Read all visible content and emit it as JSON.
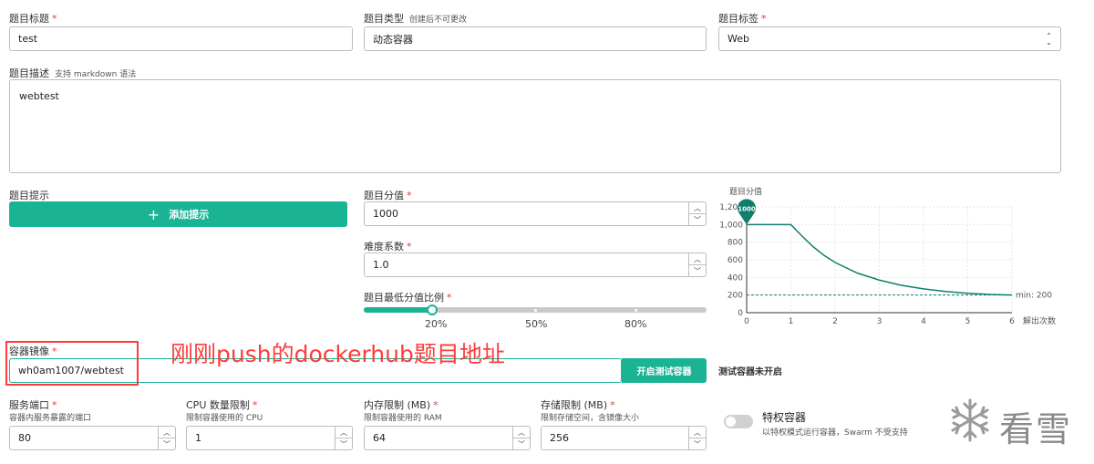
{
  "form": {
    "title": {
      "label": "题目标题",
      "value": "test"
    },
    "type": {
      "label": "题目类型",
      "hint": "创建后不可更改",
      "value": "动态容器"
    },
    "tag": {
      "label": "题目标签",
      "value": "Web"
    },
    "description": {
      "label": "题目描述",
      "hint": "支持 markdown 语法",
      "value": "webtest"
    },
    "hints": {
      "label": "题目提示",
      "add_button": "添加提示"
    },
    "score": {
      "label": "题目分值",
      "value": "1000"
    },
    "difficulty": {
      "label": "难度系数",
      "value": "1.0"
    },
    "min_ratio": {
      "label": "题目最低分值比例",
      "value_percent": 20,
      "ticks": [
        "20%",
        "50%",
        "80%"
      ]
    },
    "image": {
      "label": "容器镜像",
      "value": "wh0am1007/webtest",
      "test_button": "开启测试容器",
      "status": "测试容器未开启"
    },
    "port": {
      "label": "服务端口",
      "sub": "容器内服务暴露的端口",
      "value": "80"
    },
    "cpu": {
      "label": "CPU 数量限制",
      "sub": "限制容器使用的 CPU",
      "value": "1"
    },
    "memory": {
      "label": "内存限制 (MB)",
      "sub": "限制容器使用的 RAM",
      "value": "64"
    },
    "storage": {
      "label": "存储限制 (MB)",
      "sub": "限制存储空间，含镜像大小",
      "value": "256"
    },
    "privileged": {
      "label": "特权容器",
      "sub": "以特权模式运行容器，Swarm 不受支持",
      "enabled": false
    }
  },
  "annotation": {
    "text": "刚刚push的dockerhub题目地址",
    "color": "#ff3b3b"
  },
  "watermark": {
    "text": "看雪"
  },
  "required_mark": "*",
  "colors": {
    "accent": "#1ab394",
    "curve": "#0f7f6c"
  },
  "chart_data": {
    "type": "line",
    "title": "题目分值",
    "xlabel": "解出次数",
    "ylabel": "",
    "xlim": [
      0,
      6
    ],
    "ylim": [
      0,
      1200
    ],
    "x_ticks": [
      "0",
      "1",
      "2",
      "3",
      "4",
      "5",
      "6"
    ],
    "y_ticks": [
      "0",
      "200",
      "400",
      "600",
      "800",
      "1,000",
      "1,200"
    ],
    "series": [
      {
        "x": [
          0,
          0.5,
          1,
          1.25,
          1.5,
          1.75,
          2,
          2.5,
          3,
          3.5,
          4,
          4.5,
          5,
          5.5,
          6
        ],
        "y": [
          1000,
          1000,
          1000,
          870,
          750,
          650,
          570,
          450,
          370,
          310,
          270,
          240,
          220,
          207,
          200
        ]
      }
    ],
    "marker": {
      "x": 0,
      "y": 1000,
      "label": "1000"
    },
    "min_line": {
      "y": 200,
      "label": "min: 200"
    }
  }
}
